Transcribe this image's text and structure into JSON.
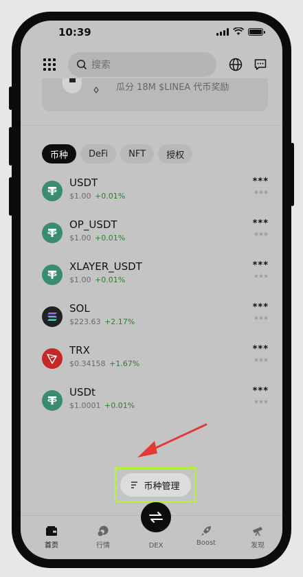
{
  "status": {
    "time": "10:39"
  },
  "search": {
    "placeholder": "搜索"
  },
  "banner": {
    "text": "瓜分 18M $LINEA 代币奖励"
  },
  "chips": [
    "币种",
    "DeFi",
    "NFT",
    "授权"
  ],
  "tokens": [
    {
      "name": "USDT",
      "price": "$1.00",
      "change": "+0.01%",
      "balance": "***",
      "value": "***",
      "icon": "tether-icon",
      "color": "#3a8c6e"
    },
    {
      "name": "OP_USDT",
      "price": "$1.00",
      "change": "+0.01%",
      "balance": "***",
      "value": "***",
      "icon": "tether-icon",
      "color": "#3a8c6e"
    },
    {
      "name": "XLAYER_USDT",
      "price": "$1.00",
      "change": "+0.01%",
      "balance": "***",
      "value": "***",
      "icon": "tether-icon",
      "color": "#3a8c6e"
    },
    {
      "name": "SOL",
      "price": "$223.63",
      "change": "+2.17%",
      "balance": "***",
      "value": "***",
      "icon": "solana-icon",
      "color": "#222222"
    },
    {
      "name": "TRX",
      "price": "$0.34158",
      "change": "+1.67%",
      "balance": "***",
      "value": "***",
      "icon": "tron-icon",
      "color": "#c62828"
    },
    {
      "name": "USDt",
      "price": "$1.0001",
      "change": "+0.01%",
      "balance": "***",
      "value": "***",
      "icon": "tether-icon",
      "color": "#3a8c6e"
    }
  ],
  "manage": {
    "label": "币种管理"
  },
  "tabs": [
    {
      "label": "首页",
      "icon": "wallet-icon"
    },
    {
      "label": "行情",
      "icon": "market-icon"
    },
    {
      "label": "DEX",
      "icon": "swap-icon"
    },
    {
      "label": "Boost",
      "icon": "rocket-icon"
    },
    {
      "label": "发现",
      "icon": "telescope-icon"
    }
  ],
  "colors": {
    "highlight": "#b7f03a",
    "arrow": "#e53935",
    "positive": "#2e7d32"
  }
}
